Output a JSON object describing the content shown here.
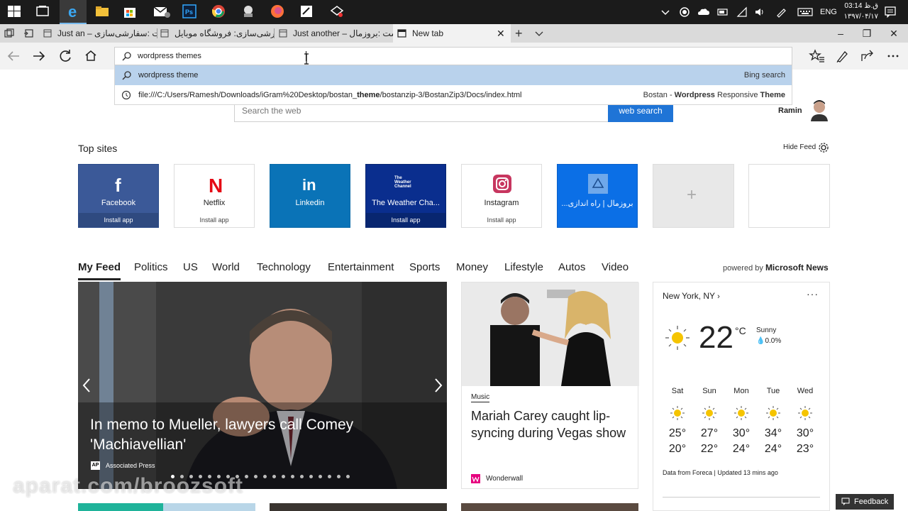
{
  "taskbar": {
    "tray": {
      "lang": "ENG",
      "time": "03:14 ق.ظ",
      "date": "۱۳۹۷/۰۴/۱۷"
    }
  },
  "tabs": [
    {
      "label": "Just an – تست :سفارشی‌سازی"
    },
    {
      "label": "سفارشی‌سازی: فروشگاه موبایل"
    },
    {
      "label": "Just another – تست :بروزمال"
    },
    {
      "label": "New tab"
    }
  ],
  "address": {
    "value": "wordpress themes"
  },
  "suggestions": [
    {
      "text": "wordpress theme",
      "right": "Bing search"
    },
    {
      "text_a": "file:///C:/Users/Ramesh/Downloads/iGram%20Desktop/bostan_",
      "text_b": "theme",
      "text_c": "/bostanzip-3/BostanZip3/Docs/index.html",
      "right_a": "Bostan - ",
      "right_b": "Wordpress",
      "right_c": " Responsive ",
      "right_d": "Theme"
    }
  ],
  "websearch": {
    "placeholder": "Search the web",
    "button": "web search"
  },
  "profile": {
    "name": "Ramin"
  },
  "topsites": {
    "heading": "Top sites",
    "hide_feed": "Hide Feed",
    "tiles": [
      {
        "label": "Facebook",
        "install": "Install app",
        "color": "#3b5998"
      },
      {
        "label": "Netflix",
        "install": "Install app",
        "color": "#ffffff"
      },
      {
        "label": "Linkedin",
        "install": "",
        "color": "#0a73b7"
      },
      {
        "label": "The Weather Cha...",
        "install": "Install app",
        "color": "#0a2e8e",
        "logo_text": "The Weather Channel"
      },
      {
        "label": "Instagram",
        "install": "Install app",
        "color": "#ffffff"
      },
      {
        "label": "...بروزمال | راه اندازی",
        "install": "",
        "color": "#0b6fe6"
      }
    ]
  },
  "feed": {
    "tabs": [
      "My Feed",
      "Politics",
      "US",
      "World",
      "Technology",
      "Entertainment",
      "Sports",
      "Money",
      "Lifestyle",
      "Autos",
      "Video"
    ],
    "powered_by": "powered by",
    "powered_brand": "Microsoft News",
    "hero": {
      "headline": "In memo to Mueller, lawyers call Comey 'Machiavellian'",
      "source": "Associated Press",
      "source_logo": "AP"
    },
    "card": {
      "category": "Music",
      "headline": "Mariah Carey caught lip-syncing during Vegas show",
      "source": "Wonderwall"
    }
  },
  "weather": {
    "location": "New York, NY",
    "temp": "22",
    "unit": "°C",
    "condition": "Sunny",
    "precip": "0.0%",
    "days": [
      {
        "name": "Sat",
        "hi": "25°",
        "lo": "20°"
      },
      {
        "name": "Sun",
        "hi": "27°",
        "lo": "22°"
      },
      {
        "name": "Mon",
        "hi": "30°",
        "lo": "24°"
      },
      {
        "name": "Tue",
        "hi": "34°",
        "lo": "24°"
      },
      {
        "name": "Wed",
        "hi": "30°",
        "lo": "23°"
      }
    ],
    "footer": "Data from Foreca | Updated 13 mins ago"
  },
  "feedback": {
    "label": "Feedback"
  },
  "watermark": "aparat.com/broozsoft",
  "colors": {
    "accent": "#1f74d6",
    "selection": "#b9d2ec"
  }
}
